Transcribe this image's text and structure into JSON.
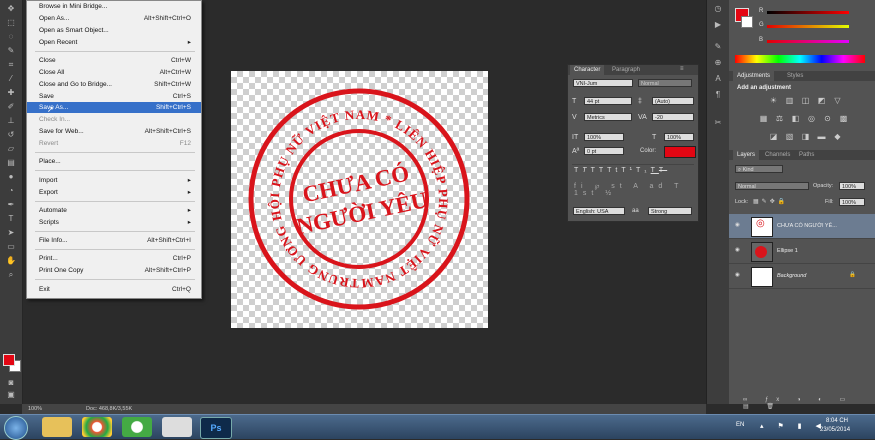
{
  "file_menu": {
    "items": [
      {
        "label": "Browse in Mini Bridge...",
        "shortcut": ""
      },
      {
        "label": "Open As...",
        "shortcut": "Alt+Shift+Ctrl+O"
      },
      {
        "label": "Open as Smart Object...",
        "shortcut": ""
      },
      {
        "label": "Open Recent",
        "shortcut": "▸"
      },
      {
        "label": "Close",
        "shortcut": "Ctrl+W"
      },
      {
        "label": "Close All",
        "shortcut": "Alt+Ctrl+W"
      },
      {
        "label": "Close and Go to Bridge...",
        "shortcut": "Shift+Ctrl+W"
      },
      {
        "label": "Save",
        "shortcut": "Ctrl+S"
      },
      {
        "label": "Save As...",
        "shortcut": "Shift+Ctrl+S"
      },
      {
        "label": "Check In...",
        "shortcut": ""
      },
      {
        "label": "Save for Web...",
        "shortcut": "Alt+Shift+Ctrl+S"
      },
      {
        "label": "Revert",
        "shortcut": "F12"
      },
      {
        "label": "Place...",
        "shortcut": ""
      },
      {
        "label": "Import",
        "shortcut": "▸"
      },
      {
        "label": "Export",
        "shortcut": "▸"
      },
      {
        "label": "Automate",
        "shortcut": "▸"
      },
      {
        "label": "Scripts",
        "shortcut": "▸"
      },
      {
        "label": "File Info...",
        "shortcut": "Alt+Shift+Ctrl+I"
      },
      {
        "label": "Print...",
        "shortcut": "Ctrl+P"
      },
      {
        "label": "Print One Copy",
        "shortcut": "Alt+Shift+Ctrl+P"
      },
      {
        "label": "Exit",
        "shortcut": "Ctrl+Q"
      }
    ]
  },
  "stamp": {
    "outer_text": "TRUNG ƯƠNG HỘI PHỤ NỮ VIỆT NAM * LIÊN HIỆP PHỤ NỮ VIỆT NAM * CHỨNG NHẬN *",
    "center_line1": "CHƯA CÓ",
    "center_line2": "NGƯỜI YÊU",
    "color": "#d9141b"
  },
  "character_panel": {
    "tab_character": "Character",
    "tab_paragraph": "Paragraph",
    "font_family": "VNI-Jum",
    "font_style": "Normal",
    "font_size": "44 pt",
    "leading": "(Auto)",
    "kerning": "Metrics",
    "tracking": "-20",
    "vscale": "100%",
    "hscale": "100%",
    "baseline": "0 pt",
    "color_label": "Color:",
    "color": "#e30613",
    "type_buttons": [
      "T",
      "T",
      "TT",
      "Tt",
      "T¹",
      "T₁",
      "T",
      "T"
    ],
    "language": "English: USA",
    "aa_label": "aa",
    "antialias": "Strong"
  },
  "color_panel": {
    "r_label": "R",
    "g_label": "G",
    "b_label": "B",
    "r_value": "230",
    "g_value": "2",
    "b_value": "2"
  },
  "adjustments": {
    "tab_adjustments": "Adjustments",
    "tab_styles": "Styles",
    "heading": "Add an adjustment"
  },
  "layers_panel": {
    "tab_layers": "Layers",
    "tab_channels": "Channels",
    "tab_paths": "Paths",
    "kind": "Kind",
    "blend_mode": "Normal",
    "opacity_label": "Opacity:",
    "opacity": "100%",
    "lock_label": "Lock:",
    "fill_label": "Fill:",
    "fill": "100%",
    "layers": [
      {
        "name": "CHƯA CÓ NGƯỜI YÊ...",
        "type": "text",
        "selected": true
      },
      {
        "name": "Ellipse 1",
        "type": "shape",
        "selected": false
      },
      {
        "name": "Background",
        "type": "background",
        "selected": false
      }
    ]
  },
  "status_bar": {
    "zoom": "100%",
    "doc": "Doc: 468,8K/3,55K"
  },
  "taskbar": {
    "language": "EN",
    "time": "8:04 CH",
    "date": "23/05/2014",
    "ps_label": "Ps"
  }
}
